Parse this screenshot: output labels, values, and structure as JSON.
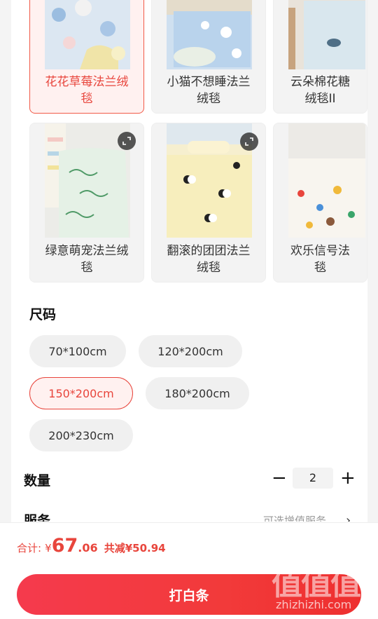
{
  "styles": {
    "products": [
      {
        "name": "花花草莓法兰绒毯",
        "selected": true
      },
      {
        "name": "小猫不想睡法兰绒毯",
        "selected": false
      },
      {
        "name": "云朵棉花糖法兰绒毯II",
        "selected": false
      },
      {
        "name": "绿意萌宠法兰绒毯",
        "selected": false
      },
      {
        "name": "翻滚的团团法兰绒毯",
        "selected": false
      },
      {
        "name": "欢乐信号法兰绒毯",
        "selected": false
      }
    ],
    "product_lines": [
      [
        "花花草莓法兰绒",
        "毯"
      ],
      [
        "小猫不想睡法兰",
        "绒毯"
      ],
      [
        "云朵棉花糖",
        "绒毯II"
      ],
      [
        "绿意萌宠法兰绒",
        "毯"
      ],
      [
        "翻滚的团团法兰",
        "绒毯"
      ],
      [
        "欢乐信号法",
        "毯"
      ]
    ]
  },
  "size": {
    "title": "尺码",
    "options": [
      "70*100cm",
      "120*200cm",
      "150*200cm",
      "180*200cm",
      "200*230cm"
    ],
    "selected": "150*200cm"
  },
  "quantity": {
    "label": "数量",
    "minus": "−",
    "plus": "+",
    "value": "2"
  },
  "service": {
    "label": "服务",
    "hint": "可选增值服务"
  },
  "summary": {
    "total_label": "合计:",
    "currency": "¥",
    "price_integer": "67",
    "price_decimal": ".06",
    "discount_text": "共减¥50.94"
  },
  "pay_button": "打白条",
  "watermark": {
    "big": "值值值",
    "small": "zhizhizhi.com"
  },
  "colors": {
    "accent": "#e8453c",
    "pay_gradient_start": "#f53a4d",
    "pay_gradient_end": "#ee2f2f"
  }
}
